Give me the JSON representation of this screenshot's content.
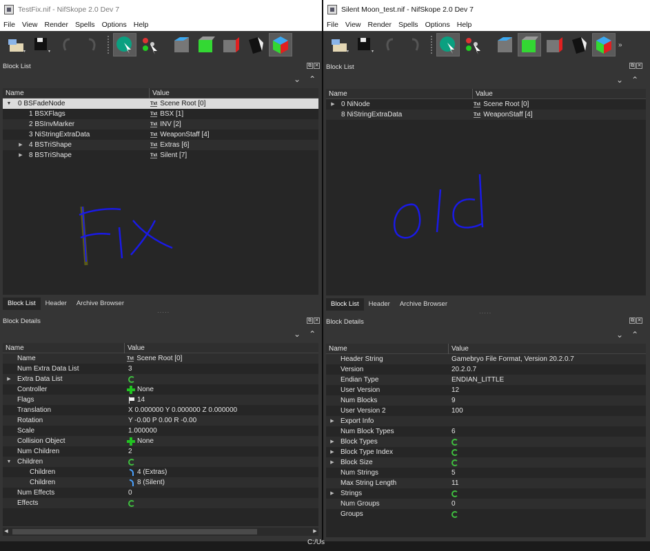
{
  "left": {
    "title": "TestFix.nif - NifSkope 2.0 Dev 7",
    "menu": [
      "File",
      "View",
      "Render",
      "Spells",
      "Options",
      "Help"
    ],
    "block_list": {
      "title": "Block List",
      "col_name": "Name",
      "col_value": "Value",
      "rows": [
        {
          "name": "0 BSFadeNode",
          "value": "Scene Root [0]"
        },
        {
          "name": "1 BSXFlags",
          "value": "BSX [1]"
        },
        {
          "name": "2 BSInvMarker",
          "value": "INV [2]"
        },
        {
          "name": "3 NiStringExtraData",
          "value": "WeaponStaff [4]"
        },
        {
          "name": "4 BSTriShape",
          "value": "Extras [6]"
        },
        {
          "name": "8 BSTriShape",
          "value": "Silent [7]"
        }
      ],
      "tabs": [
        "Block List",
        "Header",
        "Archive Browser"
      ],
      "scribble_text": "Fix"
    },
    "block_details": {
      "title": "Block Details",
      "col_name": "Name",
      "col_value": "Value",
      "rows": [
        {
          "name": "Name",
          "value": "Scene Root [0]"
        },
        {
          "name": "Num Extra Data List",
          "value": "3"
        },
        {
          "name": "Extra Data List",
          "value": ""
        },
        {
          "name": "Controller",
          "value": "None"
        },
        {
          "name": "Flags",
          "value": "14"
        },
        {
          "name": "Translation",
          "value": "X 0.000000 Y 0.000000 Z 0.000000"
        },
        {
          "name": "Rotation",
          "value": "Y -0.00 P 0.00 R -0.00"
        },
        {
          "name": "Scale",
          "value": "1.000000"
        },
        {
          "name": "Collision Object",
          "value": "None"
        },
        {
          "name": "Num Children",
          "value": "2"
        },
        {
          "name": "Children",
          "value": ""
        },
        {
          "name": "Children",
          "value": "4 (Extras)"
        },
        {
          "name": "Children",
          "value": "8 (Silent)"
        },
        {
          "name": "Num Effects",
          "value": "0"
        },
        {
          "name": "Effects",
          "value": ""
        }
      ]
    }
  },
  "right": {
    "title": "Silent Moon_test.nif - NifSkope 2.0 Dev 7",
    "menu": [
      "File",
      "View",
      "Render",
      "Spells",
      "Options",
      "Help"
    ],
    "block_list": {
      "title": "Block List",
      "col_name": "Name",
      "col_value": "Value",
      "rows": [
        {
          "name": "0 NiNode",
          "value": "Scene Root [0]"
        },
        {
          "name": "8 NiStringExtraData",
          "value": "WeaponStaff [4]"
        }
      ],
      "tabs": [
        "Block List",
        "Header",
        "Archive Browser"
      ],
      "scribble_text": "old"
    },
    "block_details": {
      "title": "Block Details",
      "col_name": "Name",
      "col_value": "Value",
      "rows": [
        {
          "name": "Header String",
          "value": "Gamebryo File Format, Version 20.2.0.7"
        },
        {
          "name": "Version",
          "value": "20.2.0.7"
        },
        {
          "name": "Endian Type",
          "value": "ENDIAN_LITTLE"
        },
        {
          "name": "User Version",
          "value": "12"
        },
        {
          "name": "Num Blocks",
          "value": "9"
        },
        {
          "name": "User Version 2",
          "value": "100"
        },
        {
          "name": "Export Info",
          "value": ""
        },
        {
          "name": "Num Block Types",
          "value": "6"
        },
        {
          "name": "Block Types",
          "value": ""
        },
        {
          "name": "Block Type Index",
          "value": ""
        },
        {
          "name": "Block Size",
          "value": ""
        },
        {
          "name": "Num Strings",
          "value": "5"
        },
        {
          "name": "Max String Length",
          "value": "11"
        },
        {
          "name": "Strings",
          "value": ""
        },
        {
          "name": "Num Groups",
          "value": "0"
        },
        {
          "name": "Groups",
          "value": ""
        }
      ]
    }
  },
  "status_text": "C:/Us",
  "icons": {
    "txt": "Txt",
    "accent_scribble": "#1a1ae6",
    "green": "#22c322"
  }
}
